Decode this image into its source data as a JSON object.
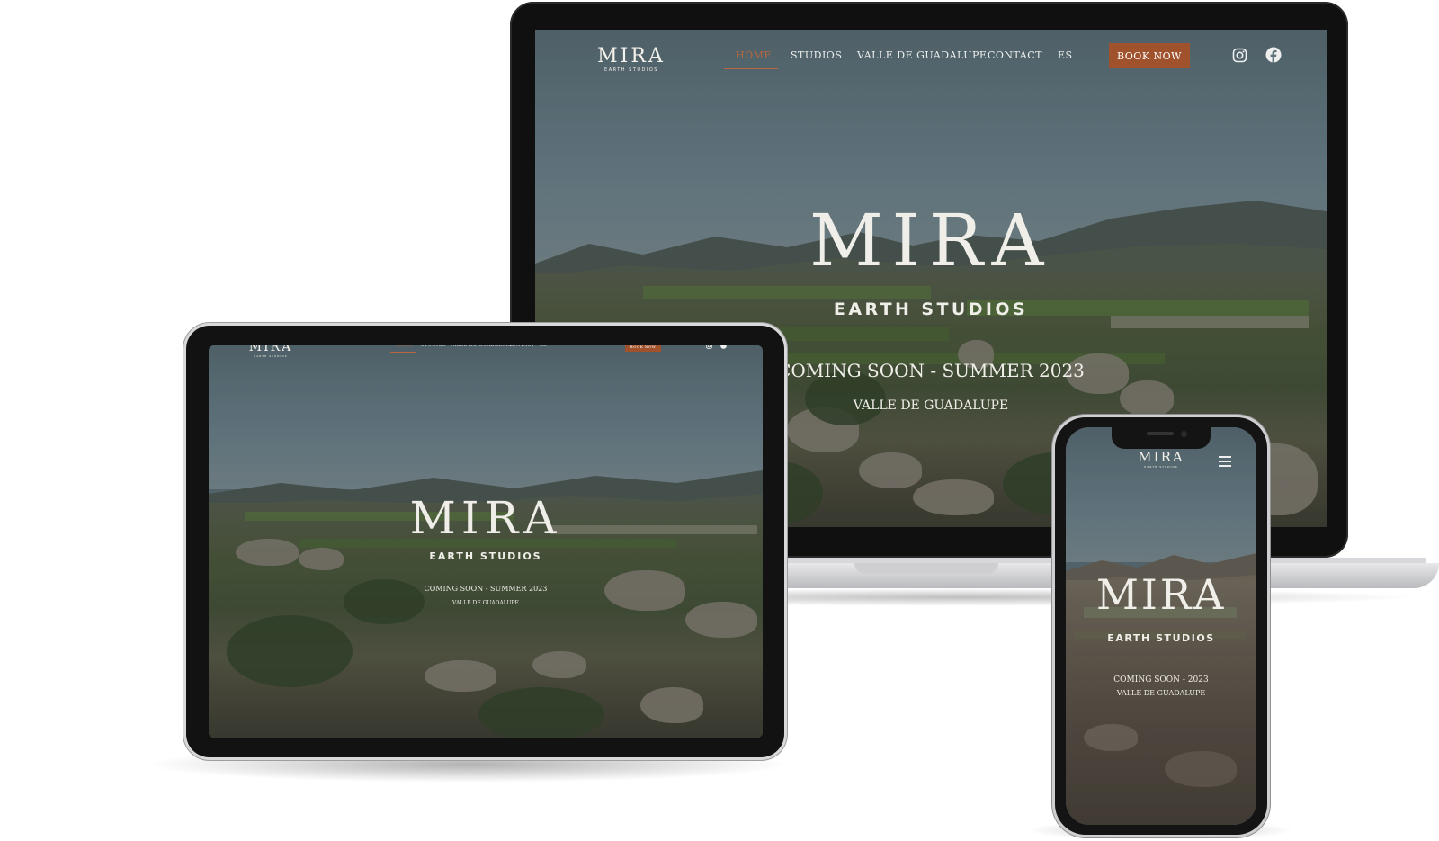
{
  "brand": {
    "name": "MIRA",
    "tagline": "EARTH STUDIOS"
  },
  "nav": {
    "home": "HOME",
    "studios": "STUDIOS",
    "valle": "VALLE DE GUADALUPE",
    "contact": "CONTACT",
    "lang": "ES",
    "book": "BOOK NOW"
  },
  "hero": {
    "title": "MIRA",
    "subtitle": "EARTH STUDIOS",
    "coming_soon": "COMING SOON - SUMMER 2023",
    "location": "VALLE DE GUADALUPE"
  },
  "mobile": {
    "coming_soon": "COMING SOON - 2023",
    "location": "VALLE DE GUADALUPE"
  },
  "icons": {
    "social1": "instagram-icon",
    "social2": "facebook-icon",
    "menu": "hamburger-menu-icon"
  },
  "colors": {
    "accent": "#a0522d",
    "text": "#efeee8"
  }
}
